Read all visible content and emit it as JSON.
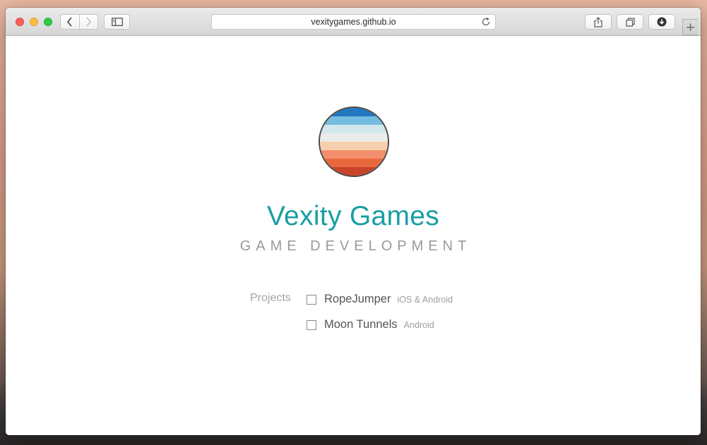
{
  "browser": {
    "url": "vexitygames.github.io",
    "new_tab_symbol": "+",
    "icons": {
      "back": "chevron-left-icon",
      "forward": "chevron-right-icon",
      "sidebar": "sidebar-icon",
      "reload": "reload-icon",
      "share": "share-icon",
      "tabs": "tabs-overview-icon",
      "download": "download-icon"
    }
  },
  "page": {
    "title": "Vexity Games",
    "tagline": "GAME DEVELOPMENT",
    "projects_label": "Projects",
    "projects": [
      {
        "name": "RopeJumper",
        "platform": "iOS & Android"
      },
      {
        "name": "Moon Tunnels",
        "platform": "Android"
      }
    ],
    "logo_stripes": [
      "#2277c0",
      "#75bde0",
      "#d2e7ec",
      "#e9ece8",
      "#f6cfae",
      "#f28e6b",
      "#e8683e",
      "#c7442a"
    ],
    "title_color": "#1a9ea4"
  }
}
